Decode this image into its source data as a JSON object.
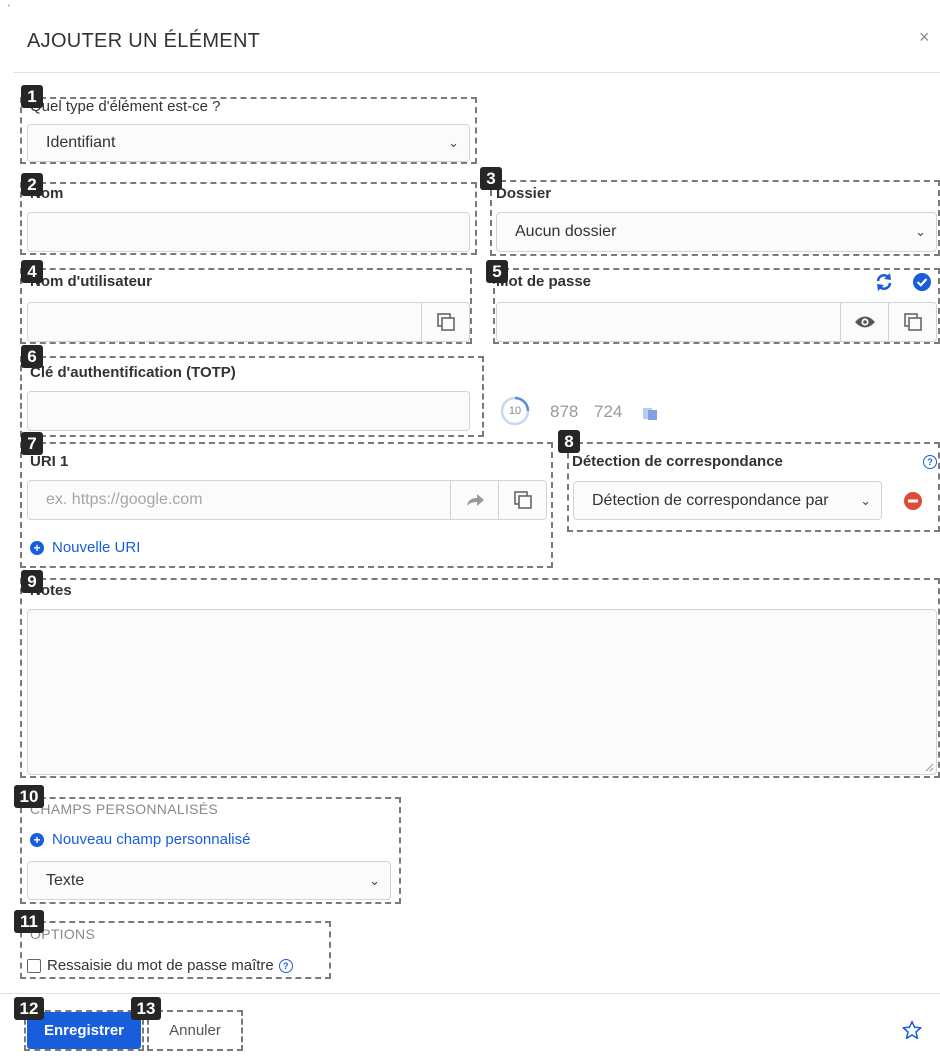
{
  "dialog": {
    "title": "AJOUTER UN ÉLÉMENT",
    "close": "×",
    "mark": "'"
  },
  "type_field": {
    "label": "Quel type d'élément est-ce ?",
    "value": "Identifiant"
  },
  "name_field": {
    "label": "Nom",
    "value": ""
  },
  "folder_field": {
    "label": "Dossier",
    "value": "Aucun dossier"
  },
  "username_field": {
    "label": "Nom d'utilisateur",
    "value": ""
  },
  "password_field": {
    "label": "Mot de passe",
    "value": ""
  },
  "totp_field": {
    "label": "Clé d'authentification (TOTP)",
    "value": "",
    "countdown": "10",
    "code_part1": "878",
    "code_part2": "724"
  },
  "uri_field": {
    "label": "URI 1",
    "placeholder": "ex. https://google.com",
    "add_uri": "Nouvelle URI"
  },
  "match_detection": {
    "label": "Détection de correspondance",
    "value": "Détection de correspondance par"
  },
  "notes_field": {
    "label": "Notes",
    "value": ""
  },
  "custom_fields": {
    "heading": "CHAMPS PERSONNALISÉS",
    "add_link": "Nouveau champ personnalisé",
    "type_value": "Texte"
  },
  "options": {
    "heading": "OPTIONS",
    "reprompt_label": "Ressaisie du mot de passe maître",
    "reprompt_checked": false
  },
  "footer": {
    "save_label": "Enregistrer",
    "cancel_label": "Annuler"
  },
  "badges": [
    "1",
    "2",
    "3",
    "4",
    "5",
    "6",
    "7",
    "8",
    "9",
    "10",
    "11",
    "12",
    "13"
  ],
  "colors": {
    "accent": "#175ddc",
    "danger": "#dd4b39",
    "badge_bg": "#262626",
    "annotation_border": "#7a7a7a"
  },
  "icons": [
    "close-icon",
    "chevron-down-icon",
    "copy-icon",
    "eye-icon",
    "refresh-icon",
    "check-circle-icon",
    "timer-icon",
    "launch-icon",
    "plus-circle-icon",
    "help-icon",
    "minus-circle-icon",
    "star-icon"
  ]
}
